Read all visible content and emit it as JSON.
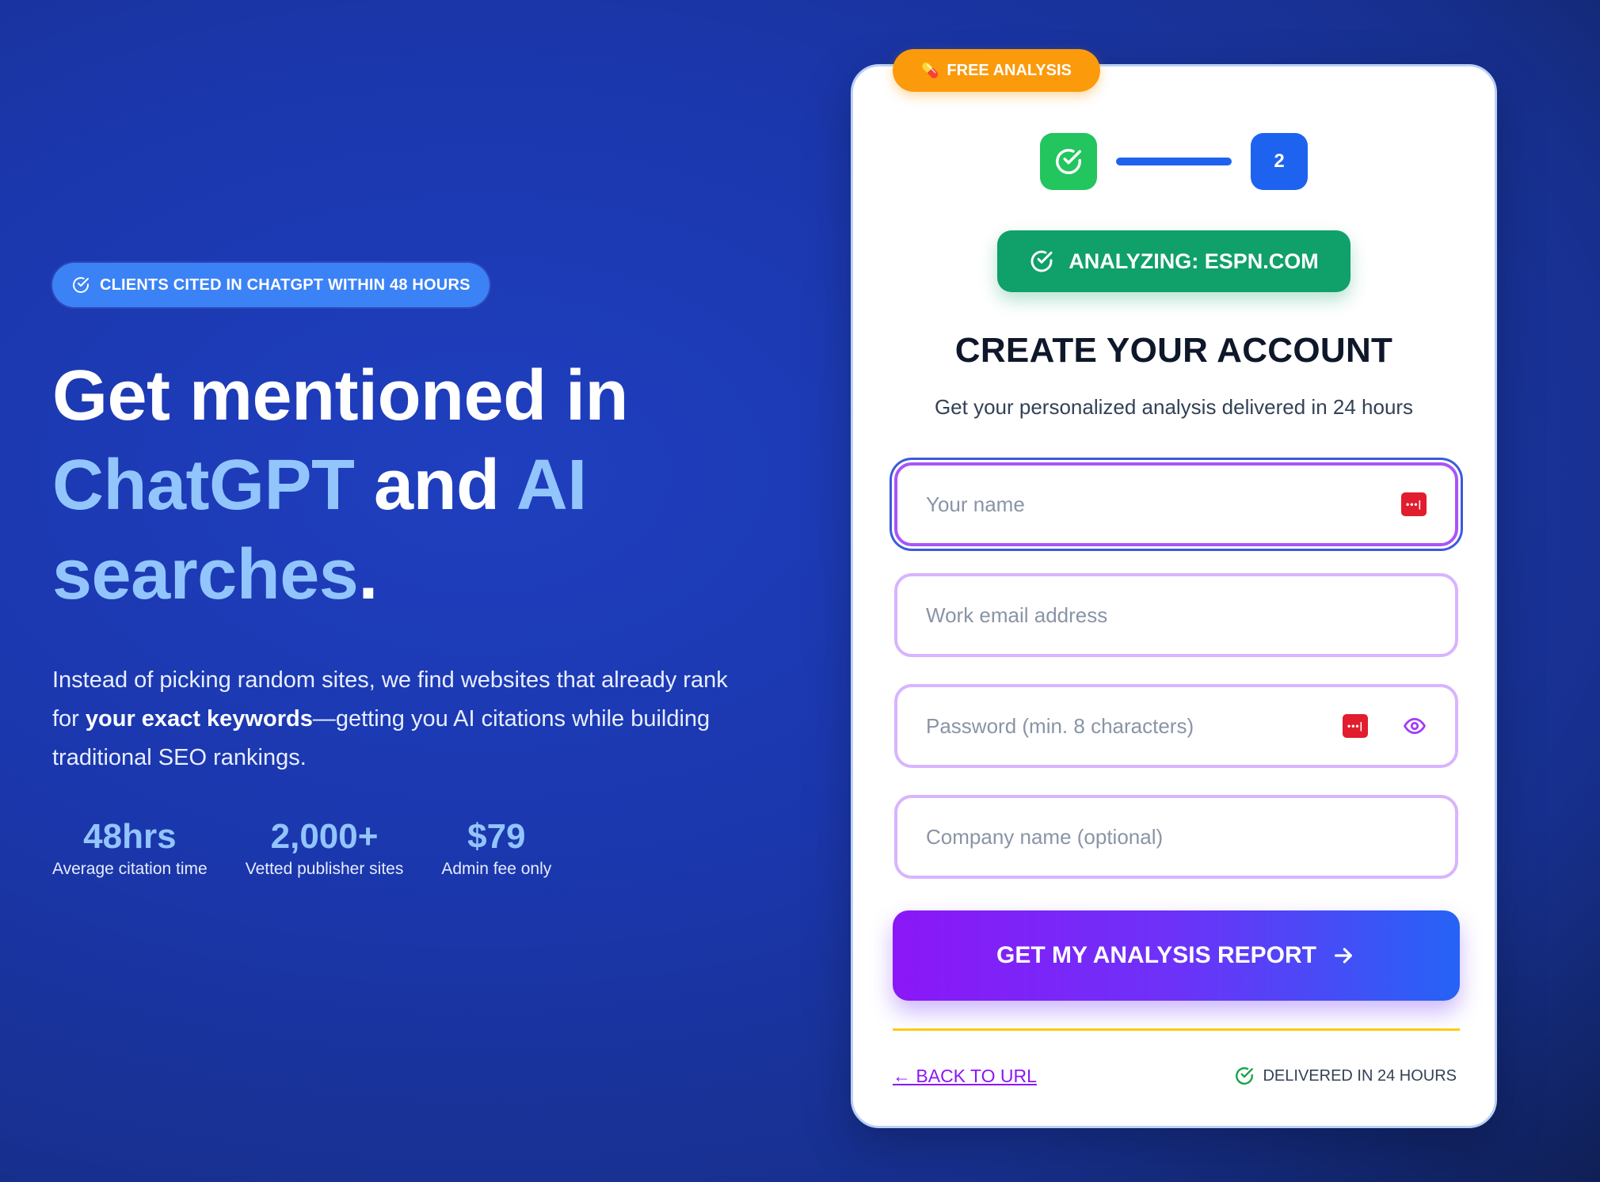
{
  "hero": {
    "badge": "CLIENTS CITED IN CHATGPT WITHIN 48 HOURS",
    "headline": {
      "part1": "Get mentioned in",
      "hl1": "ChatGPT",
      "part2": "and",
      "hl2": "AI",
      "hl3": "searches",
      "period": "."
    },
    "lede": {
      "before": "Instead of picking random sites, we find websites that already rank for ",
      "strong": "your exact keywords",
      "after": "—getting you AI citations while building traditional SEO rankings."
    },
    "stats": [
      {
        "value": "48hrs",
        "label": "Average citation time"
      },
      {
        "value": "2,000+",
        "label": "Vetted publisher sites"
      },
      {
        "value": "$79",
        "label": "Admin fee only"
      }
    ]
  },
  "card": {
    "pill": "FREE ANALYSIS",
    "step2": "2",
    "analyzing": "ANALYZING: ESPN.COM",
    "title": "CREATE YOUR ACCOUNT",
    "subtitle": "Get your personalized analysis delivered in 24 hours",
    "fields": {
      "name_placeholder": "Your name",
      "email_placeholder": "Work email address",
      "password_placeholder": "Password (min. 8 characters)",
      "company_placeholder": "Company name (optional)"
    },
    "submit": "GET MY ANALYSIS REPORT",
    "back": "← BACK TO URL",
    "delivered": "DELIVERED IN 24 HOURS"
  },
  "icons": [
    "check-circle-icon",
    "pill-icon",
    "password-manager-icon",
    "eye-icon",
    "arrow-right-icon"
  ],
  "colors": {
    "background": "#1b37ad",
    "highlight": "#93c5fd",
    "badge": "#3b82f6",
    "pill": "#fb9a0b",
    "success": "#10a06a",
    "step_done": "#22c55e",
    "step_active": "#1e63f0",
    "field_border": "#d8b4fe",
    "submit_start": "#8b17f7",
    "submit_end": "#2563f5",
    "divider": "#facc15"
  }
}
